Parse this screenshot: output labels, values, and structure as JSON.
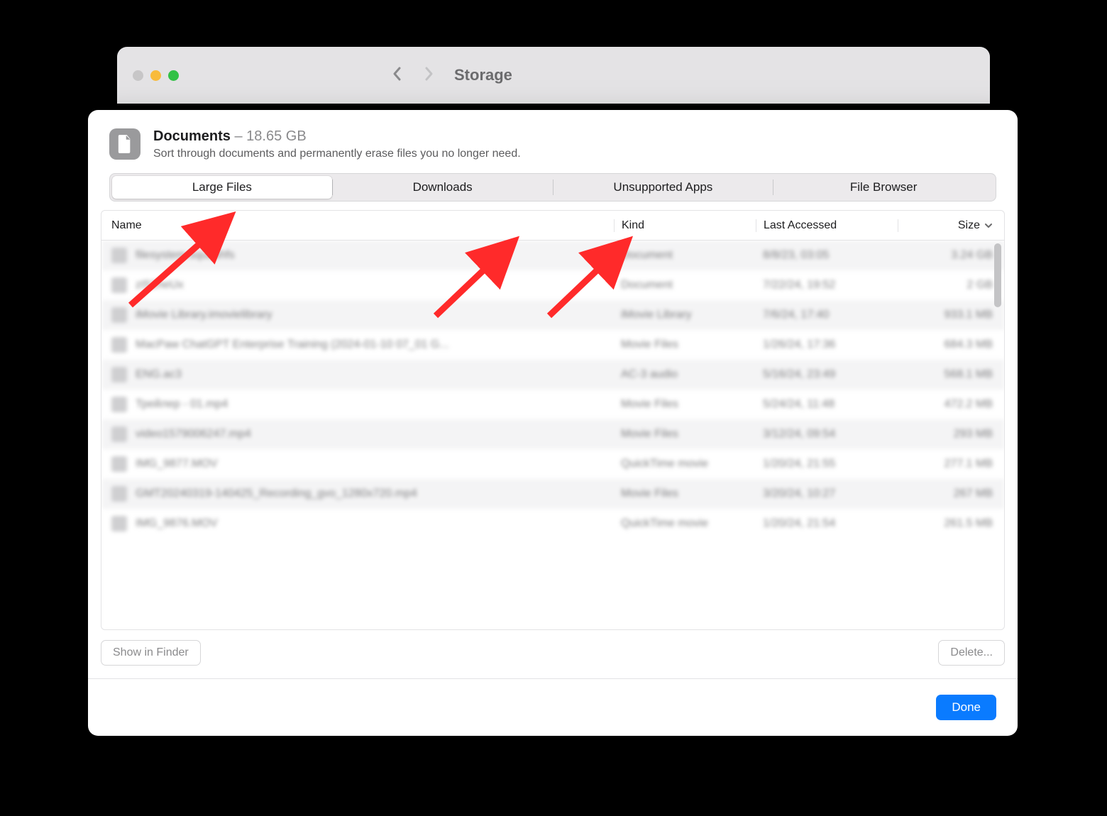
{
  "parent_window": {
    "title": "Storage"
  },
  "header": {
    "title": "Documents",
    "size": "18.65 GB",
    "subtitle": "Sort through documents and permanently erase files you no longer need."
  },
  "tabs": {
    "items": [
      "Large Files",
      "Downloads",
      "Unsupported Apps",
      "File Browser"
    ],
    "active_index": 0
  },
  "columns": {
    "name": "Name",
    "kind": "Kind",
    "last": "Last Accessed",
    "size": "Size"
  },
  "rows": [
    {
      "name": "filesystem.squashfs",
      "kind": "Document",
      "last": "8/8/23, 03:05",
      "size": "3.24 GB"
    },
    {
      "name": "zI52heUx",
      "kind": "Document",
      "last": "7/22/24, 19:52",
      "size": "2 GB"
    },
    {
      "name": "iMovie Library.imovielibrary",
      "kind": "iMovie Library",
      "last": "7/6/24, 17:40",
      "size": "933.1 MB"
    },
    {
      "name": "MacPaw ChatGPT Enterprise Training (2024-01-10 07_01 G...",
      "kind": "Movie Files",
      "last": "1/26/24, 17:36",
      "size": "684.3 MB"
    },
    {
      "name": "ENG.ac3",
      "kind": "AC-3 audio",
      "last": "5/16/24, 23:49",
      "size": "568.1 MB"
    },
    {
      "name": "Трейлер - 01.mp4",
      "kind": "Movie Files",
      "last": "5/24/24, 11:48",
      "size": "472.2 MB"
    },
    {
      "name": "video1579006247.mp4",
      "kind": "Movie Files",
      "last": "3/12/24, 09:54",
      "size": "293 MB"
    },
    {
      "name": "IMG_9877.MOV",
      "kind": "QuickTime movie",
      "last": "1/20/24, 21:55",
      "size": "277.1 MB"
    },
    {
      "name": "GMT20240319-140425_Recording_gvo_1280x720.mp4",
      "kind": "Movie Files",
      "last": "3/20/24, 10:27",
      "size": "267 MB"
    },
    {
      "name": "IMG_9876.MOV",
      "kind": "QuickTime movie",
      "last": "1/20/24, 21:54",
      "size": "261.5 MB"
    }
  ],
  "actions": {
    "show_in_finder": "Show in Finder",
    "delete": "Delete...",
    "done": "Done"
  }
}
